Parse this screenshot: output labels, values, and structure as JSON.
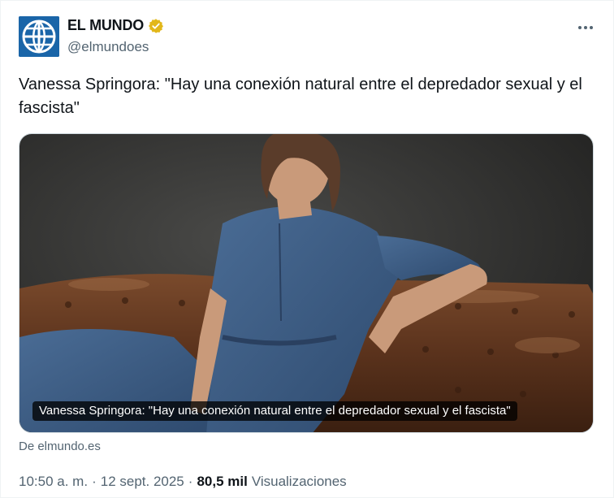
{
  "account": {
    "display_name": "EL MUNDO",
    "handle": "@elmundoes",
    "avatar_icon": "globe-logo-icon",
    "verified_icon": "gold-verified-badge-icon",
    "verified_color": "#e2b719",
    "avatar_color": "#1a65a8"
  },
  "more_icon": "more-options-icon",
  "tweet": {
    "text": "Vanessa Springora: \"Hay una conexión natural entre el depredador sexual y el fascista\""
  },
  "media": {
    "caption": "Vanessa Springora: \"Hay una conexión natural entre el depredador sexual y el fascista\"",
    "source": "De elmundo.es"
  },
  "meta": {
    "time": "10:50 a. m.",
    "separator": "·",
    "date": "12 sept. 2025",
    "views_count": "80,5 mil",
    "views_label": "Visualizaciones"
  },
  "colors": {
    "text_primary": "#0f1419",
    "text_secondary": "#536471",
    "border": "#cfd9de"
  }
}
